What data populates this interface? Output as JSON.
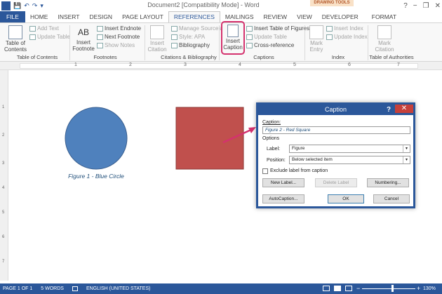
{
  "window": {
    "title": "Document2 [Compatibility Mode] - Word",
    "contextual_group": "DRAWING TOOLS",
    "help_glyph": "?",
    "minimize_glyph": "−",
    "restore_glyph": "❐",
    "close_glyph": "✕"
  },
  "qat": {
    "logo": "W",
    "save": "💾",
    "undo": "↶",
    "redo": "↷",
    "customize": "▾"
  },
  "tabs": [
    "FILE",
    "HOME",
    "INSERT",
    "DESIGN",
    "PAGE LAYOUT",
    "REFERENCES",
    "MAILINGS",
    "REVIEW",
    "VIEW",
    "DEVELOPER",
    "FORMAT"
  ],
  "ribbon": {
    "toc": {
      "button": "Table of",
      "button2": "Contents",
      "add_text": "Add Text",
      "update_table": "Update Table",
      "group": "Table of Contents"
    },
    "footnotes": {
      "insert_footnote": "Insert",
      "insert_footnote2": "Footnote",
      "ab_glyph": "AB",
      "insert_endnote": "Insert Endnote",
      "next_footnote": "Next Footnote",
      "show_notes": "Show Notes",
      "group": "Footnotes"
    },
    "citations": {
      "insert_citation": "Insert",
      "insert_citation2": "Citation",
      "manage_sources": "Manage Sources",
      "style_label": "Style:",
      "style_value": "APA",
      "bibliography": "Bibliography",
      "group": "Citations & Bibliography"
    },
    "captions": {
      "insert_caption": "Insert",
      "insert_caption2": "Caption",
      "insert_tof": "Insert Table of Figures",
      "update_table": "Update Table",
      "cross_reference": "Cross-reference",
      "group": "Captions"
    },
    "index": {
      "mark_entry": "Mark",
      "mark_entry2": "Entry",
      "insert_index": "Insert Index",
      "update_index": "Update Index",
      "group": "Index"
    },
    "toa": {
      "mark_citation": "Mark",
      "mark_citation2": "Citation",
      "group": "Table of Authorities"
    }
  },
  "ruler": {
    "marks": [
      "1",
      "2",
      "3",
      "4",
      "5",
      "6",
      "7"
    ],
    "vmarks": [
      "1",
      "2",
      "3",
      "4",
      "5",
      "6",
      "7"
    ]
  },
  "document": {
    "circle_caption": "Figure 1 - Blue Circle",
    "colors": {
      "circle": "#4f81bd",
      "circle_border": "#3a5f8f",
      "square": "#c0504d",
      "square_border": "#8c3836",
      "caption_text": "#1f4e79",
      "arrow": "#d4326e"
    }
  },
  "dialog": {
    "title": "Caption",
    "caption_label": "Caption:",
    "caption_value": "Figure 2 - Red Square",
    "options_label": "Options",
    "label_label": "Label:",
    "label_value": "Figure",
    "position_label": "Position:",
    "position_value": "Below selected item",
    "exclude_label": "Exclude label from caption",
    "new_label": "New Label...",
    "delete_label": "Delete Label",
    "numbering": "Numbering...",
    "autocaption": "AutoCaption...",
    "ok": "OK",
    "cancel": "Cancel"
  },
  "status": {
    "page": "PAGE 1 OF 1",
    "words": "5 WORDS",
    "language": "ENGLISH (UNITED STATES)",
    "zoom": "130%"
  }
}
